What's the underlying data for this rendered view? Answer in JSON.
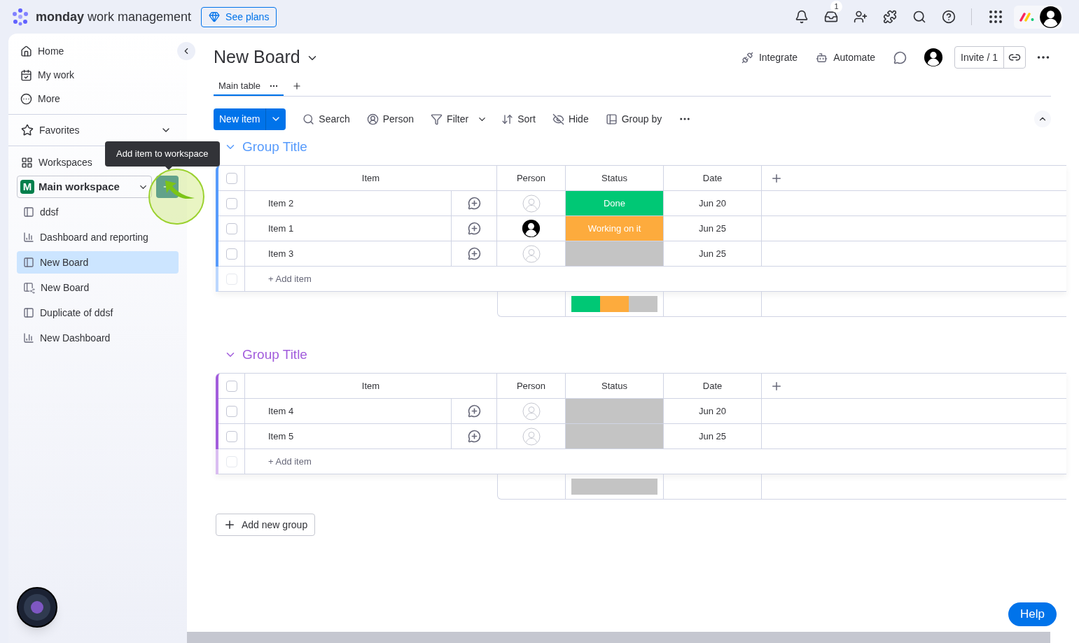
{
  "topbar": {
    "brand_bold": "monday",
    "brand_rest": "work management",
    "see_plans": "See plans",
    "inbox_badge": "1"
  },
  "sidebar": {
    "nav": [
      {
        "label": "Home",
        "kind": "home"
      },
      {
        "label": "My work",
        "kind": "mywork"
      },
      {
        "label": "More",
        "kind": "more"
      }
    ],
    "favorites": "Favorites",
    "workspaces": "Workspaces",
    "workspace_initial": "M",
    "workspace_name": "Main workspace",
    "tooltip": "Add item to workspace",
    "items": [
      {
        "label": "ddsf",
        "kind": "board",
        "selected": false
      },
      {
        "label": "Dashboard and reporting",
        "kind": "dashboard",
        "selected": false
      },
      {
        "label": "New Board",
        "kind": "board",
        "selected": true
      },
      {
        "label": "New Board",
        "kind": "shared",
        "selected": false
      },
      {
        "label": "Duplicate of ddsf",
        "kind": "board",
        "selected": false
      },
      {
        "label": "New Dashboard",
        "kind": "dashboard",
        "selected": false
      }
    ]
  },
  "board": {
    "title": "New Board",
    "actions": [
      {
        "label": "Integrate",
        "kind": "integrate"
      },
      {
        "label": "Automate",
        "kind": "automate"
      }
    ],
    "invite": "Invite / 1",
    "tabs": [
      {
        "label": "Main table",
        "selected": true
      }
    ],
    "new_item": "New item",
    "tools": [
      {
        "label": "Search",
        "kind": "search"
      },
      {
        "label": "Person",
        "kind": "person"
      },
      {
        "label": "Filter",
        "kind": "filter"
      },
      {
        "label": "Sort",
        "kind": "sort"
      },
      {
        "label": "Hide",
        "kind": "hide"
      },
      {
        "label": "Group by",
        "kind": "groupby"
      }
    ]
  },
  "groups": [
    {
      "title": "Group Title",
      "color": "#579bfc",
      "columns": [
        "Item",
        "Person",
        "Status",
        "Date"
      ],
      "header_checked": false,
      "add_row_checked": false,
      "rows": [
        {
          "checked": false,
          "item": "Item 2",
          "assigned": false,
          "status": "Done",
          "color": "#00c875",
          "date": "Jun 20"
        },
        {
          "checked": false,
          "item": "Item 1",
          "assigned": true,
          "status": "Working on it",
          "color": "#fdab3d",
          "date": "Jun 25"
        },
        {
          "checked": false,
          "item": "Item 3",
          "assigned": false,
          "color": "#c4c4c4",
          "date": "Jun 25"
        }
      ],
      "add_item": "+ Add item"
    },
    {
      "title": "Group Title",
      "color": "#a25ddc",
      "columns": [
        "Item",
        "Person",
        "Status",
        "Date"
      ],
      "header_checked": false,
      "add_row_checked": false,
      "rows": [
        {
          "checked": false,
          "item": "Item 4",
          "assigned": false,
          "color": "#c4c4c4",
          "date": "Jun 20"
        },
        {
          "checked": false,
          "item": "Item 5",
          "assigned": false,
          "color": "#c4c4c4",
          "date": "Jun 25"
        }
      ],
      "add_item": "+ Add item"
    }
  ],
  "add_group": "Add new group",
  "help": "Help"
}
